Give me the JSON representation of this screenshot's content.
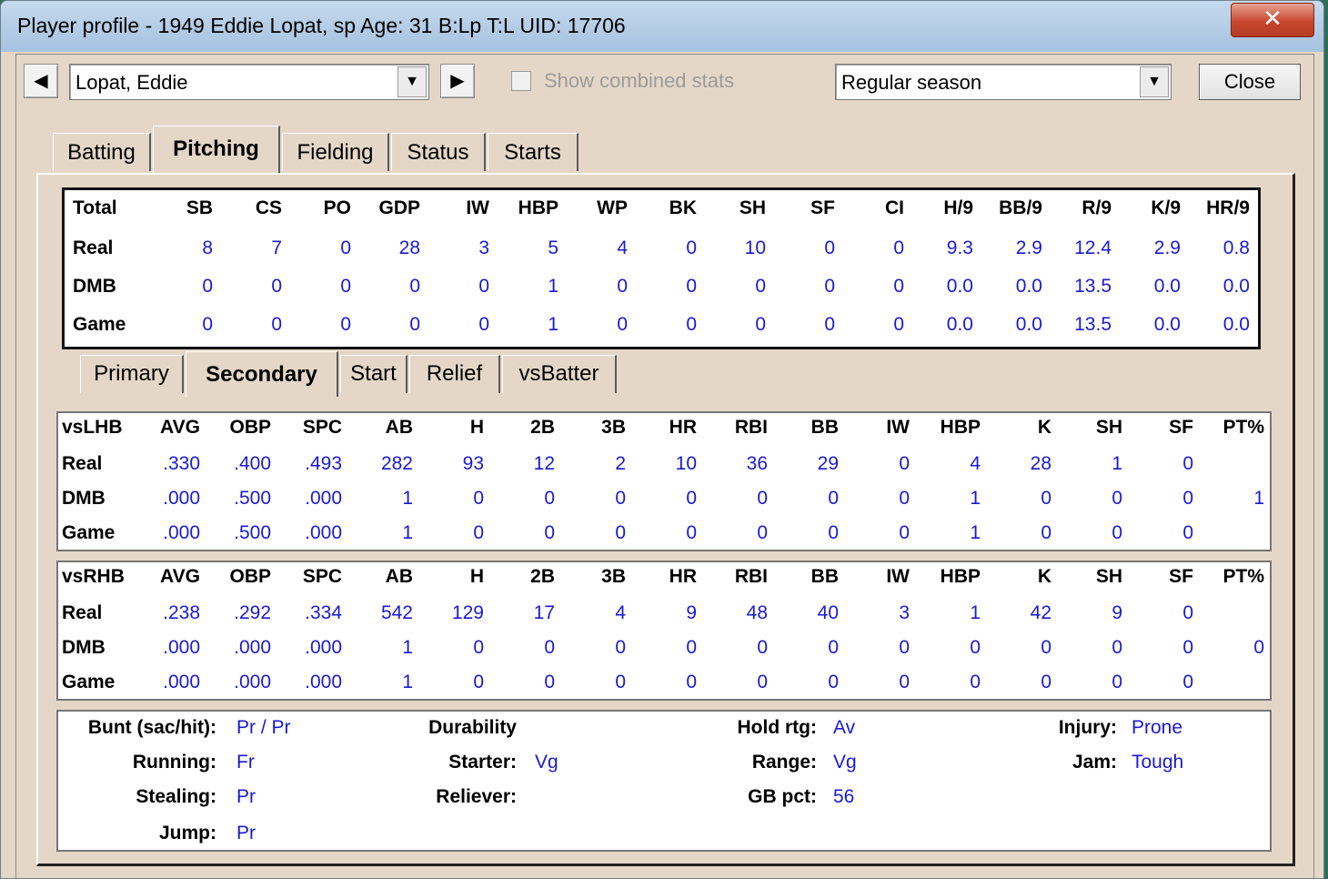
{
  "window": {
    "title": "Player profile - 1949 Eddie Lopat, sp  Age: 31  B:Lp  T:L  UID: 17706",
    "close_glyph": "✕"
  },
  "toolbar": {
    "player_select": "Lopat, Eddie",
    "show_combined_label": "Show combined stats",
    "season_select": "Regular season",
    "close_label": "Close"
  },
  "main_tabs": [
    {
      "label": "Batting"
    },
    {
      "label": "Pitching"
    },
    {
      "label": "Fielding"
    },
    {
      "label": "Status"
    },
    {
      "label": "Starts"
    }
  ],
  "totals_table": {
    "headers": [
      "Total",
      "SB",
      "CS",
      "PO",
      "GDP",
      "IW",
      "HBP",
      "WP",
      "BK",
      "SH",
      "SF",
      "CI",
      "H/9",
      "BB/9",
      "R/9",
      "K/9",
      "HR/9"
    ],
    "rows": [
      [
        "Real",
        "8",
        "7",
        "0",
        "28",
        "3",
        "5",
        "4",
        "0",
        "10",
        "0",
        "0",
        "9.3",
        "2.9",
        "12.4",
        "2.9",
        "0.8"
      ],
      [
        "DMB",
        "0",
        "0",
        "0",
        "0",
        "0",
        "1",
        "0",
        "0",
        "0",
        "0",
        "0",
        "0.0",
        "0.0",
        "13.5",
        "0.0",
        "0.0"
      ],
      [
        "Game",
        "0",
        "0",
        "0",
        "0",
        "0",
        "1",
        "0",
        "0",
        "0",
        "0",
        "0",
        "0.0",
        "0.0",
        "13.5",
        "0.0",
        "0.0"
      ]
    ]
  },
  "sub_tabs": [
    {
      "label": "Primary"
    },
    {
      "label": "Secondary"
    },
    {
      "label": "Start"
    },
    {
      "label": "Relief"
    },
    {
      "label": "vsBatter"
    }
  ],
  "vs_lhb": {
    "headers": [
      "vsLHB",
      "AVG",
      "OBP",
      "SPC",
      "AB",
      "H",
      "2B",
      "3B",
      "HR",
      "RBI",
      "BB",
      "IW",
      "HBP",
      "K",
      "SH",
      "SF",
      "PT%"
    ],
    "rows": [
      [
        "Real",
        ".330",
        ".400",
        ".493",
        "282",
        "93",
        "12",
        "2",
        "10",
        "36",
        "29",
        "0",
        "4",
        "28",
        "1",
        "0",
        ""
      ],
      [
        "DMB",
        ".000",
        ".500",
        ".000",
        "1",
        "0",
        "0",
        "0",
        "0",
        "0",
        "0",
        "0",
        "1",
        "0",
        "0",
        "0",
        "1"
      ],
      [
        "Game",
        ".000",
        ".500",
        ".000",
        "1",
        "0",
        "0",
        "0",
        "0",
        "0",
        "0",
        "0",
        "1",
        "0",
        "0",
        "0",
        ""
      ]
    ]
  },
  "vs_rhb": {
    "headers": [
      "vsRHB",
      "AVG",
      "OBP",
      "SPC",
      "AB",
      "H",
      "2B",
      "3B",
      "HR",
      "RBI",
      "BB",
      "IW",
      "HBP",
      "K",
      "SH",
      "SF",
      "PT%"
    ],
    "rows": [
      [
        "Real",
        ".238",
        ".292",
        ".334",
        "542",
        "129",
        "17",
        "4",
        "9",
        "48",
        "40",
        "3",
        "1",
        "42",
        "9",
        "0",
        ""
      ],
      [
        "DMB",
        ".000",
        ".000",
        ".000",
        "1",
        "0",
        "0",
        "0",
        "0",
        "0",
        "0",
        "0",
        "0",
        "0",
        "0",
        "0",
        "0"
      ],
      [
        "Game",
        ".000",
        ".000",
        ".000",
        "1",
        "0",
        "0",
        "0",
        "0",
        "0",
        "0",
        "0",
        "0",
        "0",
        "0",
        "0",
        ""
      ]
    ]
  },
  "attributes": {
    "col1": [
      {
        "label": "Bunt (sac/hit):",
        "value": "Pr / Pr"
      },
      {
        "label": "Running:",
        "value": "Fr"
      },
      {
        "label": "Stealing:",
        "value": "Pr"
      },
      {
        "label": "Jump:",
        "value": "Pr"
      }
    ],
    "col2": [
      {
        "label": "Durability",
        "value": ""
      },
      {
        "label": "Starter:",
        "value": "Vg"
      },
      {
        "label": "Reliever:",
        "value": ""
      }
    ],
    "col3": [
      {
        "label": "Hold rtg:",
        "value": "Av"
      },
      {
        "label": "Range:",
        "value": "Vg"
      },
      {
        "label": "GB pct:",
        "value": "56"
      }
    ],
    "col4": [
      {
        "label": "Injury:",
        "value": "Prone"
      },
      {
        "label": "Jam:",
        "value": "Tough"
      }
    ]
  }
}
